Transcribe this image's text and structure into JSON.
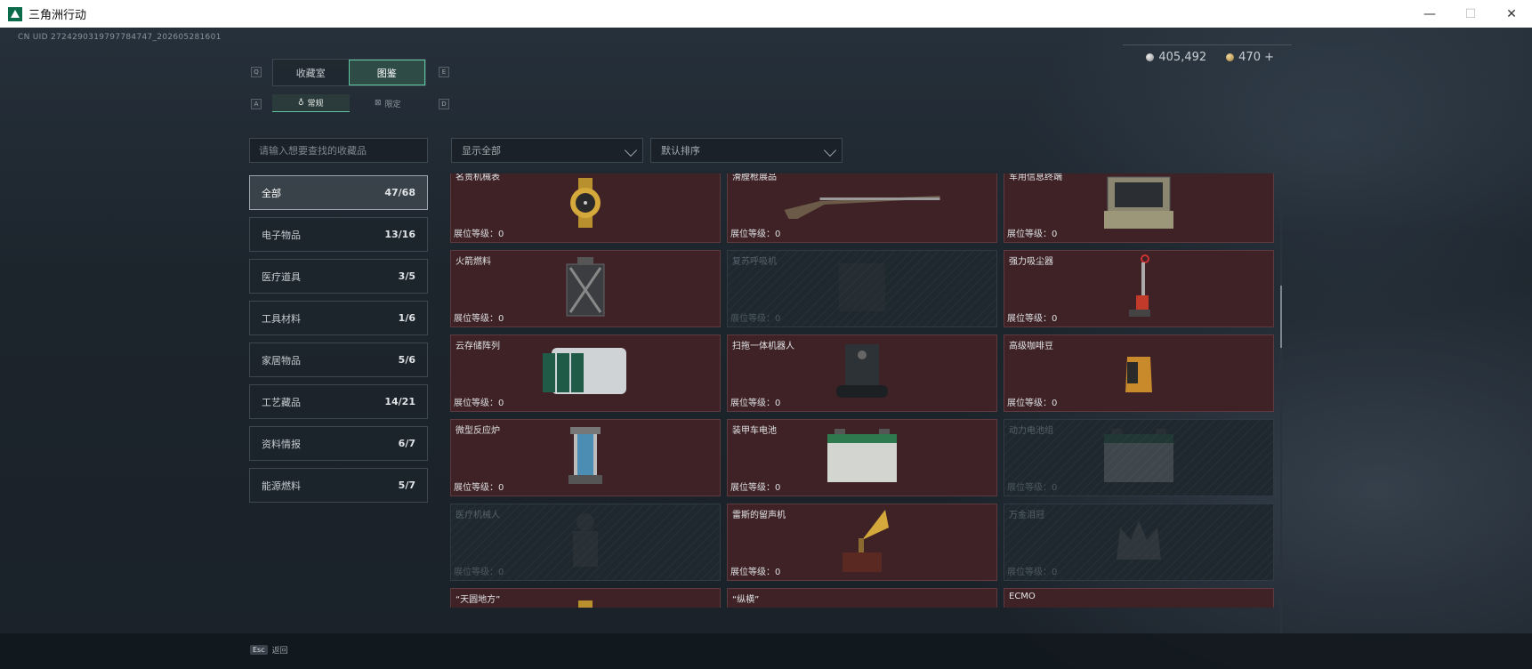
{
  "window": {
    "title": "三角洲行动",
    "min": "—",
    "max": "☐",
    "close": "✕"
  },
  "uid": "CN UID 2724290319797784747_202605281601",
  "currency": [
    {
      "icon": "silver-coin-icon",
      "value": "405,492"
    },
    {
      "icon": "gold-coin-icon",
      "value": "470 +"
    }
  ],
  "keys": {
    "q": "Q",
    "e": "E",
    "a": "A",
    "d": "D"
  },
  "tabs": [
    {
      "label": "收藏室",
      "active": false
    },
    {
      "label": "图鉴",
      "active": true
    }
  ],
  "subtabs": [
    {
      "icon": "flask-icon",
      "label": "常规",
      "active": true
    },
    {
      "icon": "limited-icon",
      "label": "限定",
      "active": false
    }
  ],
  "search": {
    "placeholder": "请输入想要查找的收藏品"
  },
  "filters": {
    "show": "显示全部",
    "sort": "默认排序"
  },
  "categories": [
    {
      "label": "全部",
      "count": "47/68",
      "active": true
    },
    {
      "label": "电子物品",
      "count": "13/16"
    },
    {
      "label": "医疗道具",
      "count": "3/5"
    },
    {
      "label": "工具材料",
      "count": "1/6"
    },
    {
      "label": "家居物品",
      "count": "5/6"
    },
    {
      "label": "工艺藏品",
      "count": "14/21"
    },
    {
      "label": "资料情报",
      "count": "6/7"
    },
    {
      "label": "能源燃料",
      "count": "5/7"
    }
  ],
  "items": [
    {
      "name": "名贵机械表",
      "level": "展位等级：0",
      "locked": false,
      "art": "watch"
    },
    {
      "name": "滑膛枪展品",
      "level": "展位等级：0",
      "locked": false,
      "art": "rifle"
    },
    {
      "name": "军用信息终端",
      "level": "展位等级：0",
      "locked": false,
      "art": "terminal"
    },
    {
      "name": "火箭燃料",
      "level": "展位等级：0",
      "locked": false,
      "art": "fuelcan"
    },
    {
      "name": "复苏呼吸机",
      "level": "展位等级：0",
      "locked": true,
      "art": "ventilator"
    },
    {
      "name": "强力吸尘器",
      "level": "展位等级：0",
      "locked": false,
      "art": "vacuum"
    },
    {
      "name": "云存储阵列",
      "level": "展位等级：0",
      "locked": false,
      "art": "server"
    },
    {
      "name": "扫拖一体机器人",
      "level": "展位等级：0",
      "locked": false,
      "art": "robot"
    },
    {
      "name": "高级咖啡豆",
      "level": "展位等级：0",
      "locked": false,
      "art": "coffee"
    },
    {
      "name": "微型反应炉",
      "level": "展位等级：0",
      "locked": false,
      "art": "reactor"
    },
    {
      "name": "装甲车电池",
      "level": "展位等级：0",
      "locked": false,
      "art": "battery"
    },
    {
      "name": "动力电池组",
      "level": "展位等级：0",
      "locked": true,
      "art": "battery"
    },
    {
      "name": "医疗机械人",
      "level": "展位等级：0",
      "locked": true,
      "art": "medbot"
    },
    {
      "name": "雷斯的留声机",
      "level": "展位等级：0",
      "locked": false,
      "art": "gramophone"
    },
    {
      "name": "万金泪冠",
      "level": "展位等级：0",
      "locked": true,
      "art": "crown"
    },
    {
      "name": "“天圆地方”",
      "level": "",
      "locked": false,
      "art": "watch"
    },
    {
      "name": "“纵横”",
      "level": "",
      "locked": false,
      "art": "scroll"
    },
    {
      "name": "ECMO",
      "level": "",
      "locked": false,
      "art": "ecmo"
    }
  ],
  "footer": {
    "key": "Esc",
    "label": "返回"
  },
  "colors": {
    "accent": "#5fc4a0",
    "card_owned": "#3e2226",
    "card_locked": "#1f282f"
  }
}
